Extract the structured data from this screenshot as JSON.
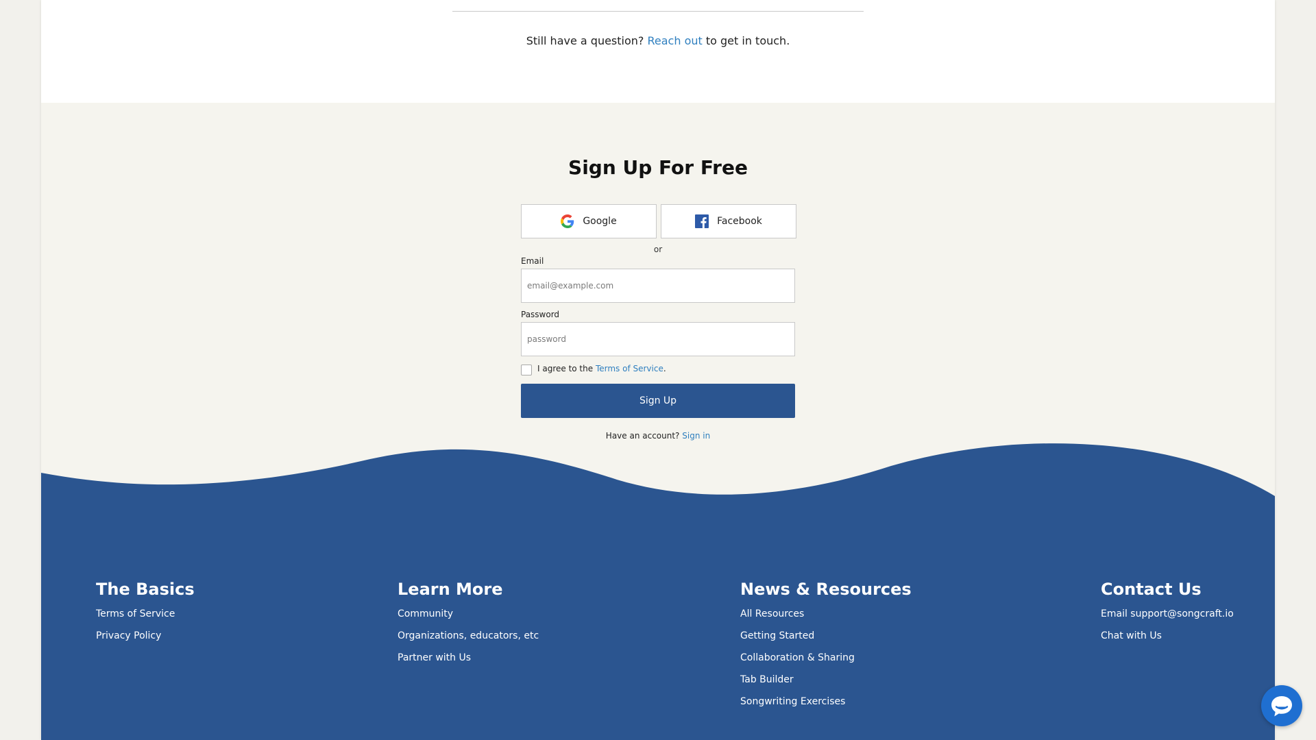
{
  "question": {
    "prefix": "Still have a question?",
    "link": "Reach out",
    "suffix": "to get in touch."
  },
  "signup": {
    "title": "Sign Up For Free",
    "google_label": "Google",
    "facebook_label": "Facebook",
    "or": "or",
    "email_label": "Email",
    "email_placeholder": "email@example.com",
    "password_label": "Password",
    "password_placeholder": "password",
    "agree_prefix": "I agree to the",
    "terms_link": "Terms of Service",
    "agree_suffix": ".",
    "submit_label": "Sign Up",
    "have_account": "Have an account?",
    "signin_link": "Sign in"
  },
  "footer": {
    "basics": {
      "title": "The Basics",
      "links": [
        "Terms of Service",
        "Privacy Policy"
      ]
    },
    "learn": {
      "title": "Learn More",
      "links": [
        "Community",
        "Organizations, educators, etc",
        "Partner with Us"
      ]
    },
    "news": {
      "title": "News & Resources",
      "links": [
        "All Resources",
        "Getting Started",
        "Collaboration & Sharing",
        "Tab Builder",
        "Songwriting Exercises"
      ]
    },
    "contact": {
      "title": "Contact Us",
      "links": [
        "Email support@songcraft.io",
        "Chat with Us"
      ]
    }
  },
  "icons": {
    "google": "google-icon",
    "facebook": "facebook-icon",
    "chat": "chat-bubble-icon"
  },
  "colors": {
    "brand_blue": "#2b5590",
    "link_blue": "#2f7fbf",
    "chat_blue": "#1f6fd1",
    "cream_background": "#f5f4ee"
  }
}
